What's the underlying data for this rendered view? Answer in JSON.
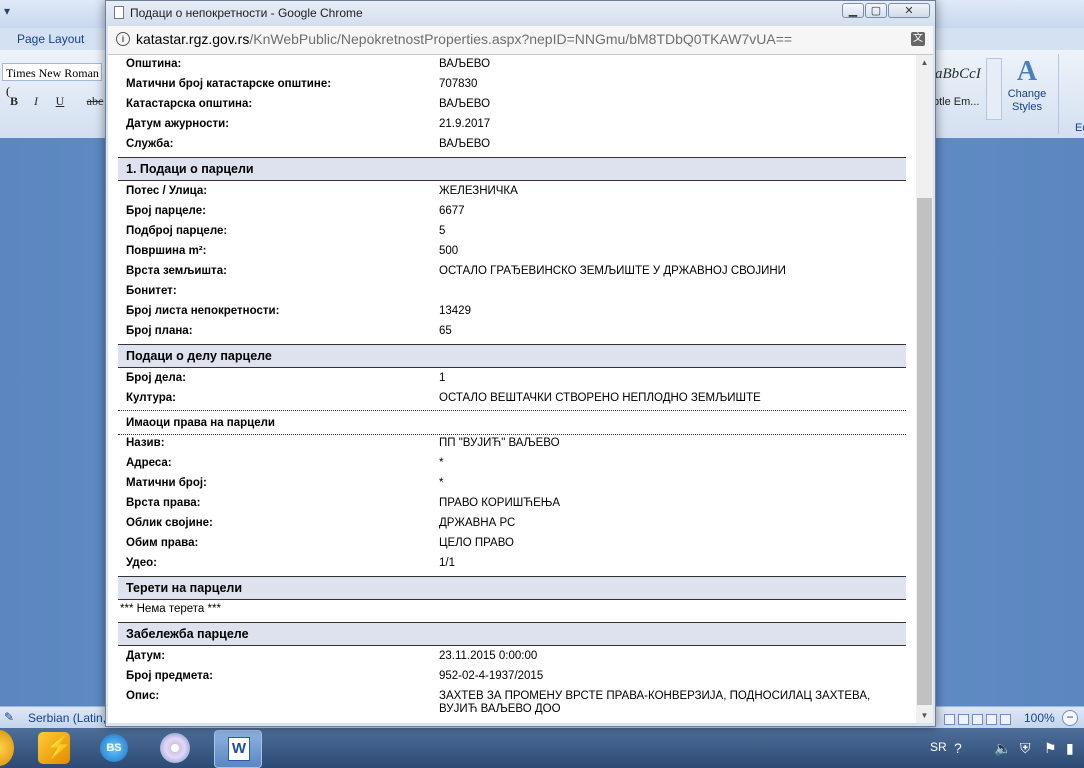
{
  "word": {
    "tabs": {
      "page_layout": "Page Layout"
    },
    "font_name": "Times New Roman (",
    "format_buttons": [
      "B",
      "I",
      "U",
      "abc"
    ],
    "style_preview": "aBbCcI",
    "style_preview_name": "btle Em...",
    "change_styles": {
      "line1": "Change",
      "line2": "Styles"
    },
    "edit_label": "Ed",
    "status": {
      "language": "Serbian (Latin,",
      "zoom": "100%"
    }
  },
  "taskbar": {
    "bs_label": "BS",
    "tray_lang": "SR"
  },
  "popup": {
    "title": "Подаци о непокретности - Google Chrome",
    "url_host": "katastar.rgz.gov.rs",
    "url_path": "/KnWebPublic/NepokretnostProperties.aspx?nepID=NNGmu/bM8TDbQ0TKAW7vUA=="
  },
  "top_fields": [
    {
      "label": "Општина:",
      "value": "ВАЉЕВО"
    },
    {
      "label": "Матични број катастарске општине:",
      "value": "707830"
    },
    {
      "label": "Катастарска општина:",
      "value": "ВАЉЕВО"
    },
    {
      "label": "Датум ажурности:",
      "value": "21.9.2017"
    },
    {
      "label": "Служба:",
      "value": "ВАЉЕВО"
    }
  ],
  "parcel": {
    "title": "1. Подаци о парцели",
    "fields": [
      {
        "label": "Потес / Улица:",
        "value": "ЖЕЛЕЗНИЧКА"
      },
      {
        "label": "Број парцеле:",
        "value": "6677"
      },
      {
        "label": "Подброј парцеле:",
        "value": "5"
      },
      {
        "label": "Површина m²:",
        "value": "500"
      },
      {
        "label": "Врста земљишта:",
        "value": "ОСТАЛО ГРАЂЕВИНСКО ЗЕМЉИШТЕ У ДРЖАВНОЈ СВОЈИНИ"
      },
      {
        "label": "Бонитет:",
        "value": ""
      },
      {
        "label": "Број листа непокретности:",
        "value": "13429"
      },
      {
        "label": "Број плана:",
        "value": "65"
      }
    ]
  },
  "part": {
    "title": "Подаци о делу парцеле",
    "fields": [
      {
        "label": "Број дела:",
        "value": "1"
      },
      {
        "label": "Култура:",
        "value": "ОСТАЛО ВЕШТАЧКИ СТВОРЕНО НЕПЛОДНО ЗЕМЉИШТЕ"
      }
    ]
  },
  "owners": {
    "title": "Имаоци права на парцели",
    "fields": [
      {
        "label": "Назив:",
        "value": "ПП \"ВУЈИЋ\" ВАЉЕВО"
      },
      {
        "label": "Адреса:",
        "value": "*"
      },
      {
        "label": "Матични број:",
        "value": "*"
      },
      {
        "label": "Врста права:",
        "value": "ПРАВО КОРИШЋЕЊА"
      },
      {
        "label": "Облик својине:",
        "value": "ДРЖАВНА РС"
      },
      {
        "label": "Обим права:",
        "value": "ЦЕЛО ПРАВО"
      },
      {
        "label": "Удео:",
        "value": "1/1"
      }
    ]
  },
  "burdens": {
    "title": "Терети на парцели",
    "text": "*** Нема терета ***"
  },
  "notes": {
    "title": "Забележба парцеле",
    "fields": [
      {
        "label": "Датум:",
        "value": "23.11.2015 0:00:00"
      },
      {
        "label": "Број предмета:",
        "value": "952-02-4-1937/2015"
      },
      {
        "label": "Опис:",
        "value": "ЗАХТЕВ ЗА ПРОМЕНУ ВРСТЕ ПРАВА-КОНВЕРЗИЈА, ПОДНОСИЛАЦ ЗАХТЕВА,",
        "value2": "ВУЈИЋ ВАЉЕВО ДОО"
      }
    ]
  }
}
